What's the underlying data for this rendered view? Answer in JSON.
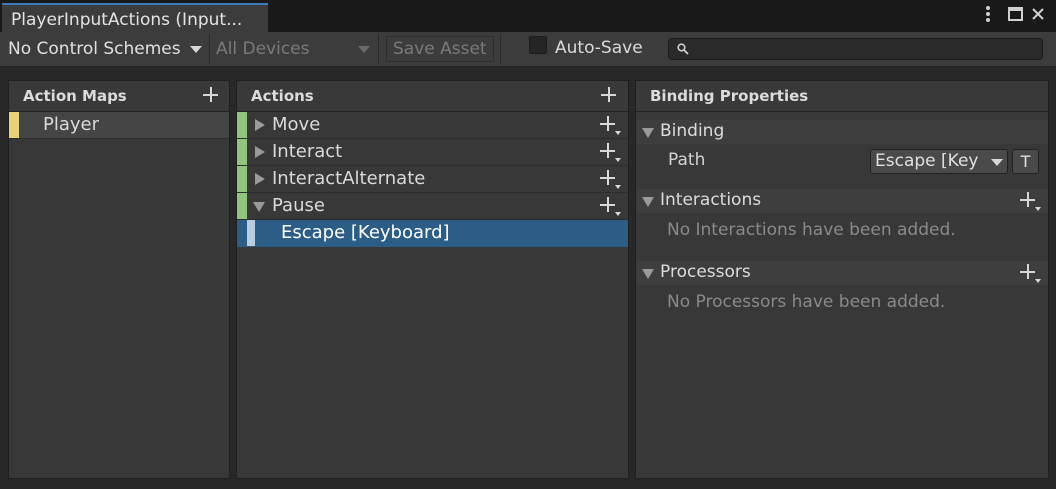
{
  "window": {
    "tab_title": "PlayerInputActions (Input...",
    "menu_icon": "kebab-menu-icon",
    "maximize_icon": "maximize-icon",
    "close_icon": "close-icon"
  },
  "toolbar": {
    "control_schemes": "No Control Schemes",
    "devices": "All Devices",
    "save_asset": "Save Asset",
    "auto_save_label": "Auto-Save",
    "auto_save_checked": false,
    "search_value": "",
    "search_icon": "search-icon"
  },
  "action_maps": {
    "header": "Action Maps",
    "items": [
      {
        "label": "Player",
        "selected": true
      }
    ]
  },
  "actions": {
    "header": "Actions",
    "items": [
      {
        "label": "Move",
        "expanded": false
      },
      {
        "label": "Interact",
        "expanded": false
      },
      {
        "label": "InteractAlternate",
        "expanded": false
      },
      {
        "label": "Pause",
        "expanded": true
      }
    ],
    "binding": {
      "label": "Escape [Keyboard]",
      "selected": true
    }
  },
  "binding_properties": {
    "header": "Binding Properties",
    "binding_section": "Binding",
    "path_label": "Path",
    "path_value": "Escape [Key",
    "t_button": "T",
    "interactions_section": "Interactions",
    "interactions_empty": "No Interactions have been added.",
    "processors_section": "Processors",
    "processors_empty": "No Processors have been added."
  },
  "colors": {
    "action_map_accent": "#e9d07a",
    "action_accent": "#93c47d",
    "binding_accent": "#b9cde0",
    "selection": "#2c5d87",
    "tab_accent": "#3a79bb"
  }
}
